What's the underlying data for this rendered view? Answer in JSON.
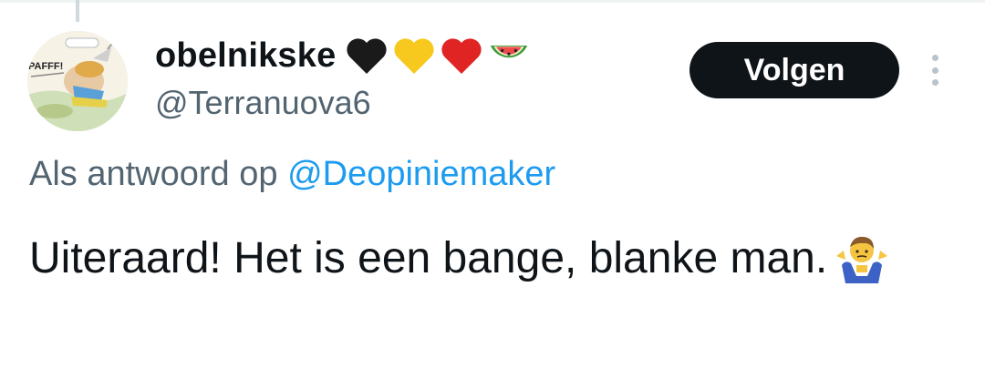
{
  "user": {
    "display_name": "obelnikske",
    "handle": "@Terranuova6",
    "name_badges": [
      "black-heart-icon",
      "yellow-heart-icon",
      "red-heart-icon",
      "watermelon-icon"
    ],
    "avatar_text": "PAFFF!"
  },
  "follow_button": {
    "label": "Volgen"
  },
  "more_menu": {
    "icon": "more-vertical-icon"
  },
  "reply_context": {
    "prefix": "Als antwoord op",
    "mention": "@Deopiniemaker"
  },
  "tweet": {
    "text": "Uiteraard! Het is een bange, blanke man.",
    "trailing_emoji": "person-shrugging-icon"
  },
  "colors": {
    "text_primary": "#0f1419",
    "text_secondary": "#536471",
    "link": "#1d9bf0",
    "button_bg": "#0f1419",
    "button_text": "#ffffff"
  }
}
